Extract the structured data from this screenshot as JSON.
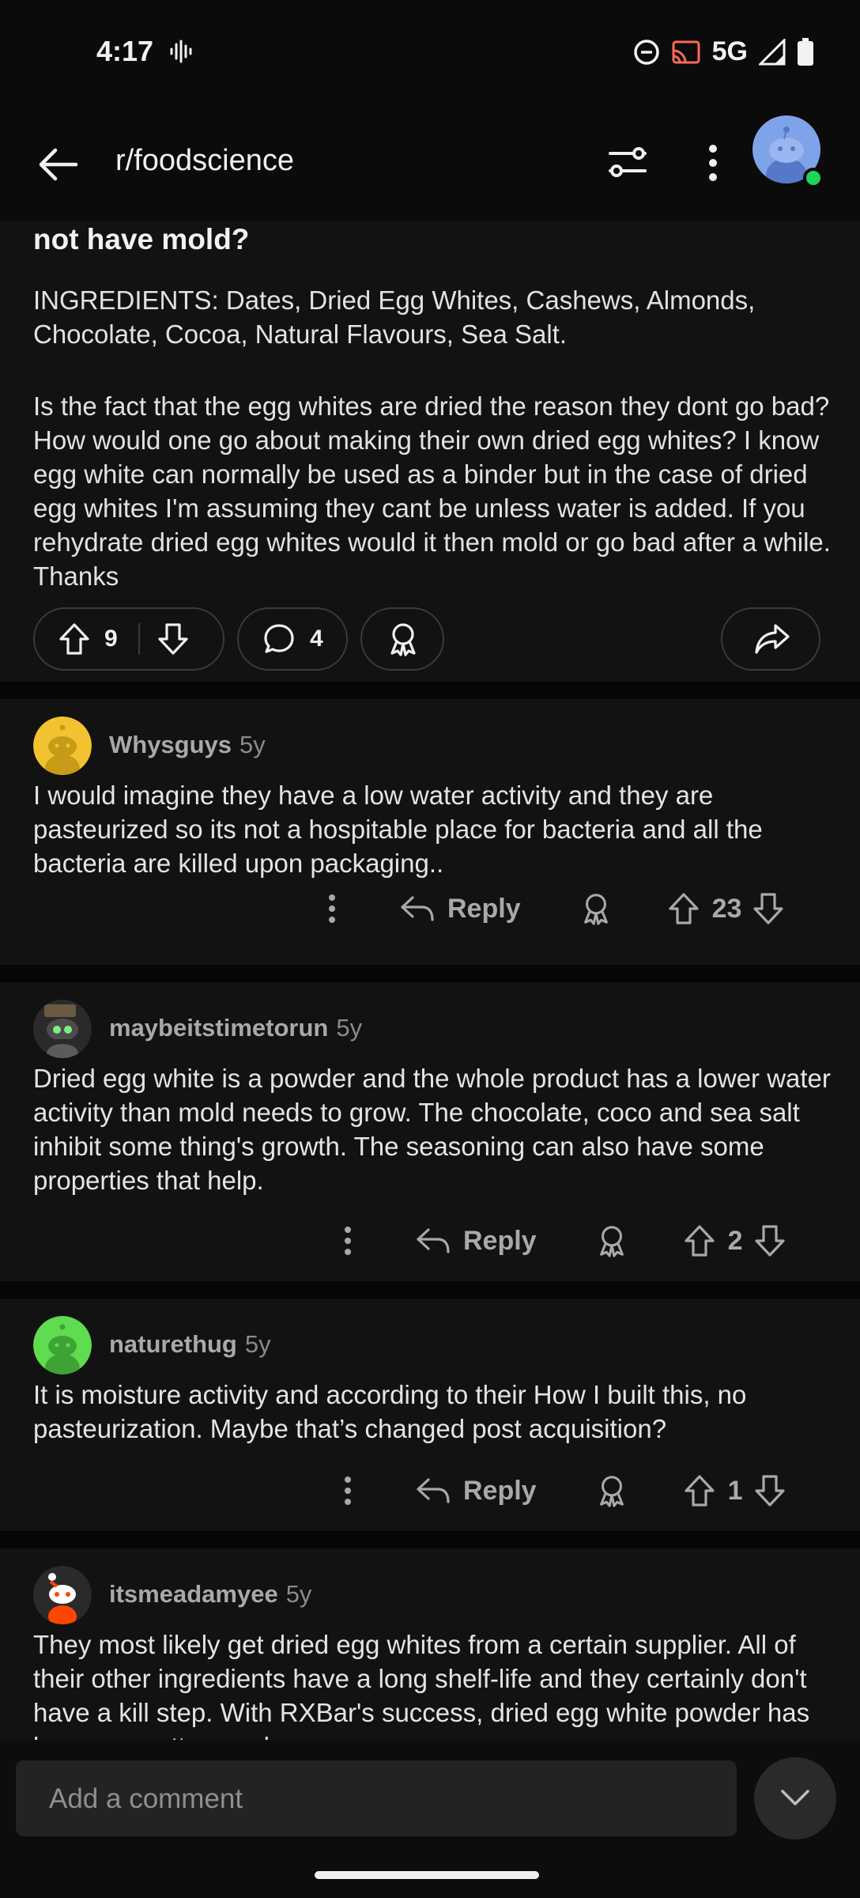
{
  "status": {
    "time": "4:17",
    "network": "5G"
  },
  "header": {
    "title": "r/foodscience"
  },
  "post": {
    "title_fragment": "not have mold?",
    "ingredients": "INGREDIENTS: Dates, Dried Egg Whites, Cashews, Almonds, Chocolate, Cocoa, Natural Flavours, Sea Salt.",
    "body": "Is the fact that the egg whites are dried the reason they dont go bad? How would one go about making their own dried egg whites? I know egg white can normally be used as a binder but in the case of dried egg whites I'm assuming they cant be unless water is added. If you rehydrate dried egg whites would it then mold or go bad after a while. Thanks",
    "votes": "9",
    "comments": "4"
  },
  "comments": [
    {
      "user": "Whysguys",
      "age": "5y",
      "text": "I would imagine they have a low water activity and they are pasteurized so its not a hospitable place for bacteria and all the bacteria are killed upon packaging..",
      "reply_label": "Reply",
      "votes": "23",
      "avatar_color": "#f2c230"
    },
    {
      "user": "maybeitstimetorun",
      "age": "5y",
      "text": "Dried egg white is a powder and the whole product has a lower water activity than mold needs to grow.  The chocolate, coco and sea salt inhibit some thing's growth. The seasoning can also have some properties that help.",
      "reply_label": "Reply",
      "votes": "2",
      "avatar_color": "#3b3b3b"
    },
    {
      "user": "naturethug",
      "age": "5y",
      "text": "It is moisture activity and according to their How I built this, no pasteurization. Maybe that’s changed post acquisition?",
      "reply_label": "Reply",
      "votes": "1",
      "avatar_color": "#5fdc4f"
    },
    {
      "user": "itsmeadamyee",
      "age": "5y",
      "text": "They most likely get dried egg whites from a certain supplier. All of their other ingredients have a long shelf-life and they certainly don't have a kill step. With RXBar's success, dried egg white powder has become pretty popular",
      "avatar_color": "#2a2a2a"
    }
  ],
  "composer": {
    "placeholder": "Add a comment"
  }
}
